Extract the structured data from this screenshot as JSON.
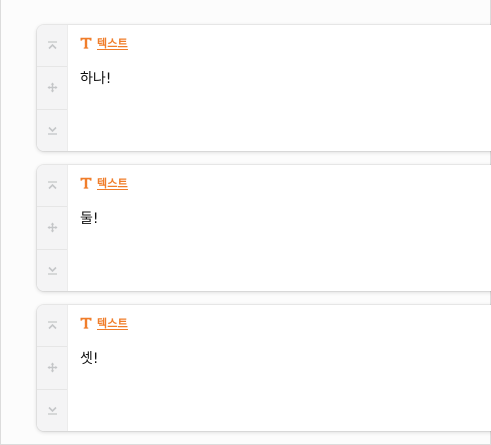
{
  "colors": {
    "accent": "#f07d2a",
    "handle_icon": "#c4c6c8"
  },
  "cards": [
    {
      "type_icon": "text-type-icon",
      "type_label": "텍스트",
      "text": "하나!",
      "controls": [
        "move-up-icon",
        "drag-move-icon",
        "move-down-icon"
      ]
    },
    {
      "type_icon": "text-type-icon",
      "type_label": "텍스트",
      "text": "둘!",
      "controls": [
        "move-up-icon",
        "drag-move-icon",
        "move-down-icon"
      ]
    },
    {
      "type_icon": "text-type-icon",
      "type_label": "텍스트",
      "text": "셋!",
      "controls": [
        "move-up-icon",
        "drag-move-icon",
        "move-down-icon"
      ]
    }
  ]
}
